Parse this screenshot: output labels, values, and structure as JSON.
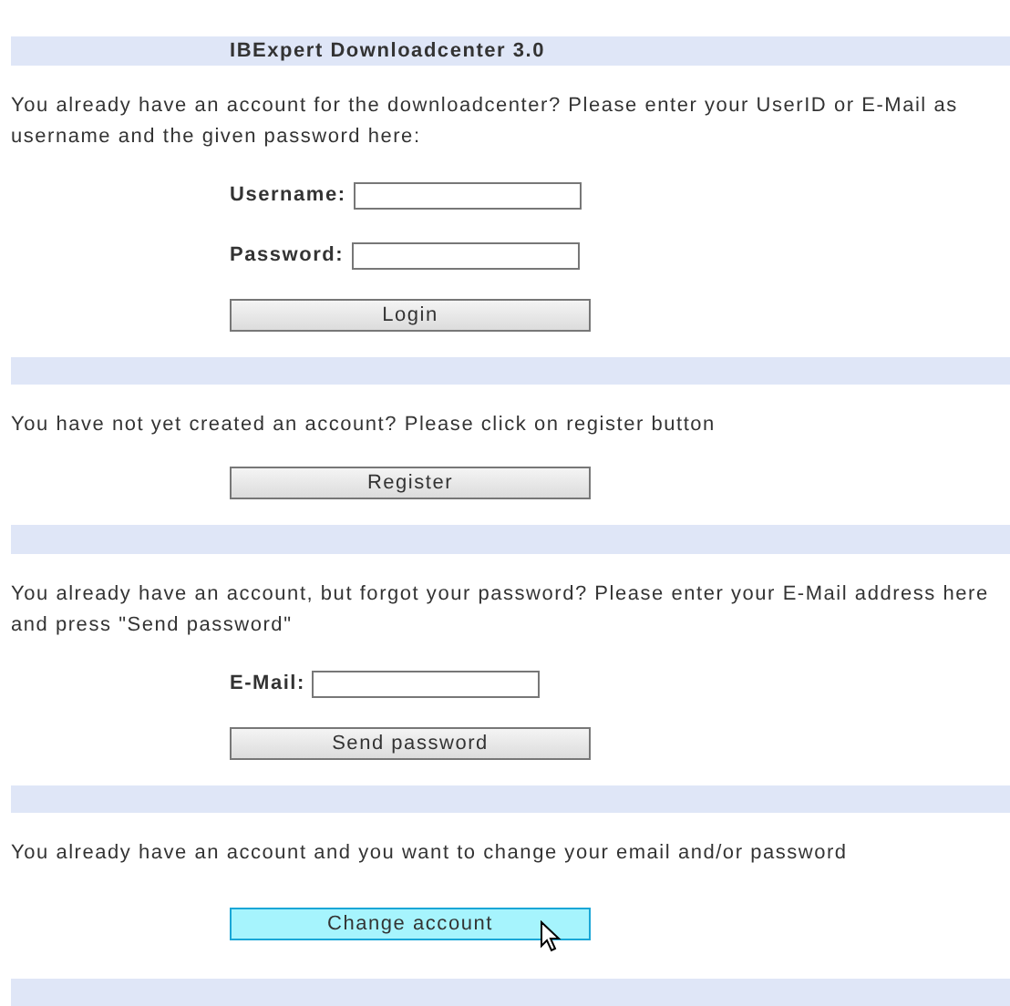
{
  "blocks": [
    {
      "kind": "band",
      "title": "IBExpert Downloadcenter 3.0"
    },
    {
      "kind": "text",
      "text": "You already have an account for the downloadcenter? Please enter your UserID or E-Mail as username and the given password here:"
    },
    {
      "kind": "field",
      "label": "Username:"
    },
    {
      "kind": "field",
      "label": "Password:"
    },
    {
      "kind": "button",
      "label": "Login",
      "hovered": false
    },
    {
      "kind": "band"
    },
    {
      "kind": "text",
      "text": "You have not yet created an account? Please click on register button"
    },
    {
      "kind": "button",
      "label": "Register",
      "hovered": false
    },
    {
      "kind": "band"
    },
    {
      "kind": "text",
      "text": "You already have an account, but forgot your password? Please enter your E-Mail address here and press \"Send password\""
    },
    {
      "kind": "field",
      "label": "E-Mail:"
    },
    {
      "kind": "button",
      "label": "Send password",
      "hovered": false
    },
    {
      "kind": "band"
    },
    {
      "kind": "text",
      "text": "You already have an account and you want to change your email and/or password"
    },
    {
      "kind": "button",
      "label": "Change account",
      "hovered": true
    },
    {
      "kind": "band"
    }
  ]
}
